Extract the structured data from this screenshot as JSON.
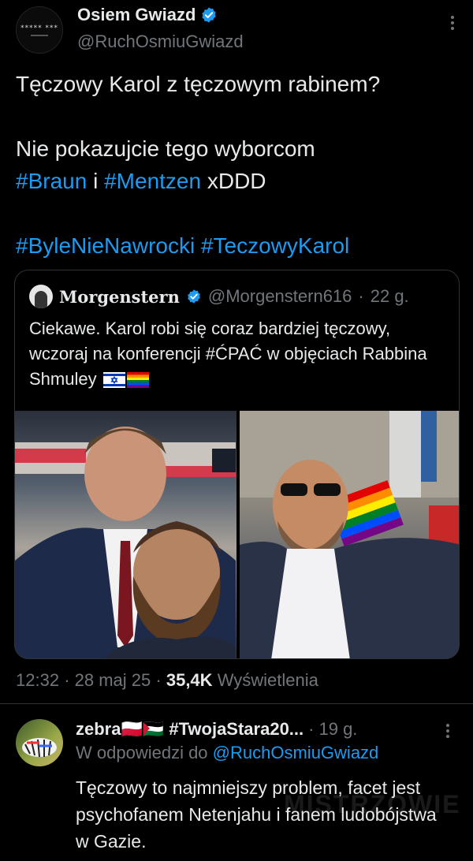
{
  "tweet": {
    "author": {
      "avatar_text": "***** ***",
      "display_name": "Osiem Gwiazd",
      "handle": "@RuchOsmiuGwiazd",
      "verified": true
    },
    "line1": "Tęczowy Karol z tęczowym rabinem?",
    "line2_text": "Nie pokazujcie tego wyborcom",
    "tag_braun": "#Braun",
    "conj": "i",
    "tag_mentzen": "#Mentzen",
    "suffix": "xDDD",
    "tag_byle": "#ByleNieNawrocki",
    "tag_teczowy": "#TeczowyKarol",
    "time": "12:32",
    "date": "28 maj 25",
    "views_count": "35,4K",
    "views_label": "Wyświetlenia",
    "sep": "·"
  },
  "quote": {
    "display_name": "Morgenstern",
    "handle": "@Morgenstern616",
    "age": "22 g.",
    "sep": "·",
    "text": "Ciekawe. Karol robi się coraz bardziej tęczowy, wczoraj na konferencji #ĆPAĆ w objęciach Rabbina Shmuley"
  },
  "reply": {
    "display_name": "zebra🇵🇱🇵🇸 #TwojaStara20...",
    "sep": "·",
    "age": "19 g.",
    "reply_prefix": "W odpowiedzi do",
    "reply_handle": "@RuchOsmiuGwiazd",
    "text": "Tęczowy to najmniejszy problem, facet jest psychofanem Netenjahu i fanem ludobójstwa w Gazie."
  },
  "watermark": "MISTRZOWIE",
  "colors": {
    "background": "#000000",
    "text": "#e7e9ea",
    "muted": "#71767b",
    "link": "#1d9bf0",
    "border": "#2f3336",
    "verified": "#1d9bf0"
  }
}
